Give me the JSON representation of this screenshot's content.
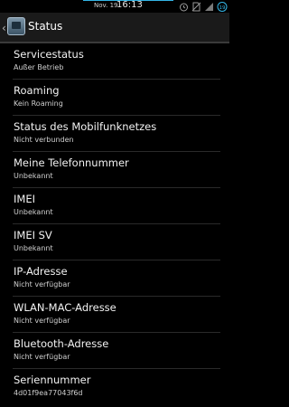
{
  "statusbar": {
    "date": "Nov. 19",
    "time": "16:13",
    "icons": [
      "alarm-icon",
      "no-sim-icon",
      "signal-icon",
      "battery-icon"
    ],
    "accent": "#33b5e5",
    "battery_badge": "19"
  },
  "actionbar": {
    "title": "Status",
    "icon": "settings-app-icon"
  },
  "items": [
    {
      "label": "Servicestatus",
      "value": "Außer Betrieb"
    },
    {
      "label": "Roaming",
      "value": "Kein Roaming"
    },
    {
      "label": "Status des Mobilfunknetzes",
      "value": "Nicht verbunden"
    },
    {
      "label": "Meine Telefonnummer",
      "value": "Unbekannt"
    },
    {
      "label": "IMEI",
      "value": "Unbekannt"
    },
    {
      "label": "IMEI SV",
      "value": "Unbekannt"
    },
    {
      "label": "IP-Adresse",
      "value": "Nicht verfügbar"
    },
    {
      "label": "WLAN-MAC-Adresse",
      "value": "Nicht verfügbar"
    },
    {
      "label": "Bluetooth-Adresse",
      "value": "Nicht verfügbar"
    },
    {
      "label": "Seriennummer",
      "value": "4d01f9ea77043f6d"
    }
  ]
}
